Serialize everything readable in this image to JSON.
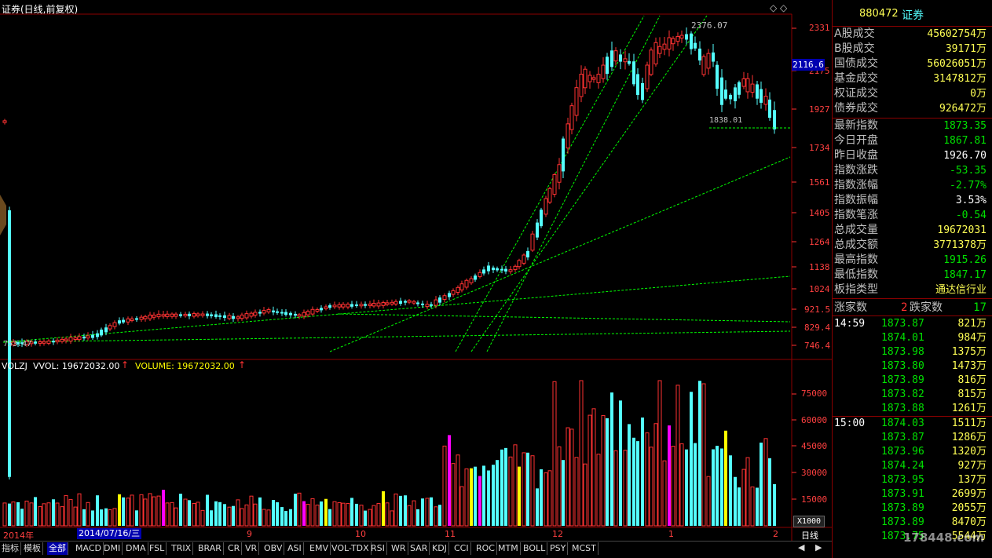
{
  "title": "证券(日线,前复权)",
  "window_controls": {
    "diamond": "◇",
    "diamond2": "◇"
  },
  "price_axis": {
    "labels": [
      "2331",
      "2175",
      "1927",
      "1734",
      "1561",
      "1405",
      "1264",
      "1138",
      "1024",
      "921.5",
      "829.4",
      "746.4"
    ],
    "current_price_tag": "2116.6"
  },
  "annotations": {
    "high": "2376.07",
    "low": "1838.01",
    "start": "753.47"
  },
  "volume_panel": {
    "header_prefix": "VOLZJ",
    "vvol": "VVOL: 19672032.00",
    "volume": "VOLUME: 19672032.00",
    "axis_labels": [
      "75000",
      "60000",
      "45000",
      "30000",
      "15000"
    ],
    "unit": "X1000"
  },
  "date_axis": {
    "labels": [
      "2014年",
      "9",
      "10",
      "11",
      "12",
      "1",
      "2"
    ],
    "cursor_date": "2014/07/16/三",
    "period": "日线"
  },
  "panel": {
    "code": "880472",
    "name": "证券",
    "rows_volume": [
      {
        "label": "A股成交",
        "value": "45602754万"
      },
      {
        "label": "B股成交",
        "value": "39171万"
      },
      {
        "label": "国债成交",
        "value": "56026051万"
      },
      {
        "label": "基金成交",
        "value": "3147812万"
      },
      {
        "label": "权证成交",
        "value": "0万"
      },
      {
        "label": "债券成交",
        "value": "926472万"
      }
    ],
    "rows_index": [
      {
        "label": "最新指数",
        "value": "1873.35",
        "color": "#00e000"
      },
      {
        "label": "今日开盘",
        "value": "1867.81",
        "color": "#00e000"
      },
      {
        "label": "昨日收盘",
        "value": "1926.70",
        "color": "#ffffff"
      },
      {
        "label": "指数涨跌",
        "value": "-53.35",
        "color": "#00e000"
      },
      {
        "label": "指数涨幅",
        "value": "-2.77%",
        "color": "#00e000"
      },
      {
        "label": "指数振幅",
        "value": "3.53%",
        "color": "#ffffff"
      },
      {
        "label": "指数笔涨",
        "value": "-0.54",
        "color": "#00e000"
      },
      {
        "label": "总成交量",
        "value": "19672031",
        "color": "#ffff55"
      },
      {
        "label": "总成交额",
        "value": "3771378万",
        "color": "#ffff55"
      },
      {
        "label": "最高指数",
        "value": "1915.26",
        "color": "#00e000"
      },
      {
        "label": "最低指数",
        "value": "1847.17",
        "color": "#00e000"
      },
      {
        "label": "板指类型",
        "value": "通达信行业",
        "color": "#ffff55"
      }
    ],
    "updown": {
      "up_label": "涨家数",
      "up": "2",
      "down_label": "跌家数",
      "down": "17"
    },
    "ticks_a_time": "14:59",
    "ticks_a": [
      {
        "price": "1873.87",
        "vol": "821万"
      },
      {
        "price": "1874.01",
        "vol": "984万"
      },
      {
        "price": "1873.98",
        "vol": "1375万"
      },
      {
        "price": "1873.80",
        "vol": "1473万"
      },
      {
        "price": "1873.89",
        "vol": "816万"
      },
      {
        "price": "1873.82",
        "vol": "815万"
      },
      {
        "price": "1873.88",
        "vol": "1261万"
      }
    ],
    "ticks_b_time": "15:00",
    "ticks_b": [
      {
        "price": "1874.03",
        "vol": "1511万"
      },
      {
        "price": "1873.87",
        "vol": "1286万"
      },
      {
        "price": "1873.96",
        "vol": "1320万"
      },
      {
        "price": "1874.24",
        "vol": "927万"
      },
      {
        "price": "1873.95",
        "vol": "137万"
      },
      {
        "price": "1873.91",
        "vol": "2699万"
      },
      {
        "price": "1873.89",
        "vol": "2055万"
      },
      {
        "price": "1873.89",
        "vol": "8470万"
      },
      {
        "price": "1873.75",
        "vol": "5544万"
      }
    ],
    "watermark": "178448.com"
  },
  "tabs": [
    "指标",
    "模板",
    "全部",
    "MACD",
    "DMI",
    "DMA",
    "FSL",
    "TRIX",
    "BRAR",
    "CR",
    "VR",
    "OBV",
    "ASI",
    "EMV",
    "VOL-TDX",
    "RSI",
    "WR",
    "SAR",
    "KDJ",
    "CCI",
    "ROC",
    "MTM",
    "BOLL",
    "PSY",
    "MCST"
  ],
  "active_tab": "全部",
  "colors": {
    "up": "#ff3232",
    "down": "#54ffff",
    "volume_highlight_yellow": "#ffff00",
    "volume_highlight_magenta": "#ff00ff",
    "trendline": "#00ff00"
  }
}
